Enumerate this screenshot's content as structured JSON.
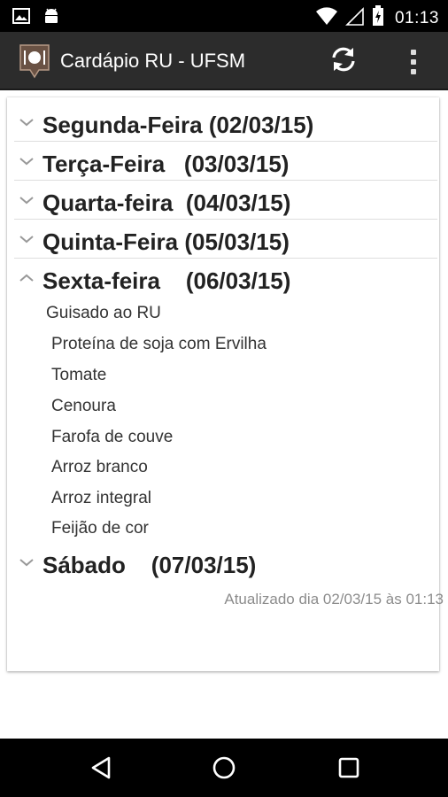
{
  "status_bar": {
    "time": "01:13",
    "left_icons": [
      "image-icon",
      "android-icon"
    ],
    "right_icons": [
      "wifi-icon",
      "signal-icon",
      "battery-icon"
    ]
  },
  "action_bar": {
    "title": "Cardápio RU - UFSM",
    "background": "#2c2c2c",
    "icons": [
      "app-menu-icon",
      "refresh-icon",
      "overflow-menu-icon"
    ]
  },
  "menu": {
    "days": [
      {
        "label": "Segunda-Feira (02/03/15)",
        "expanded": false
      },
      {
        "label": "Terça-Feira   (03/03/15)",
        "expanded": false
      },
      {
        "label": "Quarta-feira  (04/03/15)",
        "expanded": false
      },
      {
        "label": "Quinta-Feira (05/03/15)",
        "expanded": false
      },
      {
        "label": "Sexta-feira    (06/03/15)",
        "expanded": true
      },
      {
        "label": "Sábado    (07/03/15)",
        "expanded": false
      }
    ],
    "friday_items": [
      "Guisado ao RU",
      "Proteína de soja com Ervilha",
      "Tomate",
      "Cenoura",
      "Farofa de couve",
      "Arroz branco",
      "Arroz integral",
      "Feijão de cor"
    ]
  },
  "footer": {
    "updated_text": "Atualizado dia 02/03/15 às 01:13"
  },
  "nav_bar": {
    "icons": [
      "back-icon",
      "home-icon",
      "recents-icon"
    ]
  }
}
